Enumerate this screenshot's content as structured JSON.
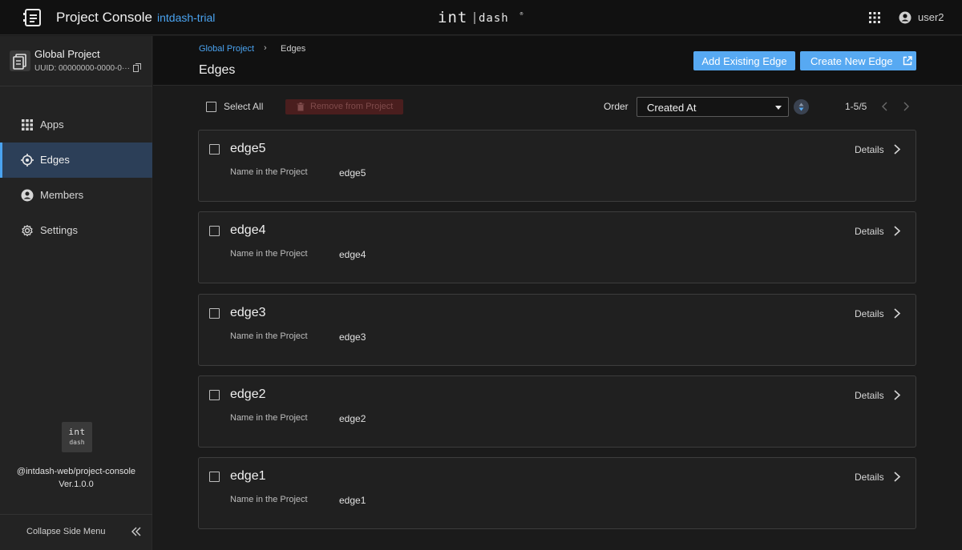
{
  "topbar": {
    "app_title": "Project Console",
    "tenant": "intdash-trial",
    "brand": "intdash",
    "user_name": "user2"
  },
  "sidebar": {
    "project_name": "Global Project",
    "project_uuid": "UUID: 00000000-0000-0···",
    "nav": [
      {
        "label": "Apps",
        "icon": "apps-grid-icon",
        "active": false
      },
      {
        "label": "Edges",
        "icon": "edges-target-icon",
        "active": true
      },
      {
        "label": "Members",
        "icon": "members-person-icon",
        "active": false
      },
      {
        "label": "Settings",
        "icon": "settings-gear-icon",
        "active": false
      }
    ],
    "logo_line1": "int",
    "logo_line2": "dash",
    "package": "@intdash-web/project-console",
    "version": "Ver.1.0.0",
    "collapse_label": "Collapse Side Menu"
  },
  "header": {
    "breadcrumb_root": "Global Project",
    "breadcrumb_sep": "›",
    "breadcrumb_current": "Edges",
    "title": "Edges",
    "add_existing_label": "Add Existing Edge",
    "create_new_label": "Create New Edge"
  },
  "toolbar": {
    "select_all_label": "Select All",
    "remove_label": "Remove from Project",
    "order_label": "Order",
    "order_value": "Created At",
    "pager": "1-5/5"
  },
  "edges": [
    {
      "name": "edge5",
      "field_label": "Name in the Project",
      "field_value": "edge5",
      "details": "Details"
    },
    {
      "name": "edge4",
      "field_label": "Name in the Project",
      "field_value": "edge4",
      "details": "Details"
    },
    {
      "name": "edge3",
      "field_label": "Name in the Project",
      "field_value": "edge3",
      "details": "Details"
    },
    {
      "name": "edge2",
      "field_label": "Name in the Project",
      "field_value": "edge2",
      "details": "Details"
    },
    {
      "name": "edge1",
      "field_label": "Name in the Project",
      "field_value": "edge1",
      "details": "Details"
    }
  ],
  "colors": {
    "accent": "#57a9f2",
    "link": "#4aa3f0",
    "active_nav": "#2c3f58",
    "danger_bg": "#4a1e1e"
  }
}
